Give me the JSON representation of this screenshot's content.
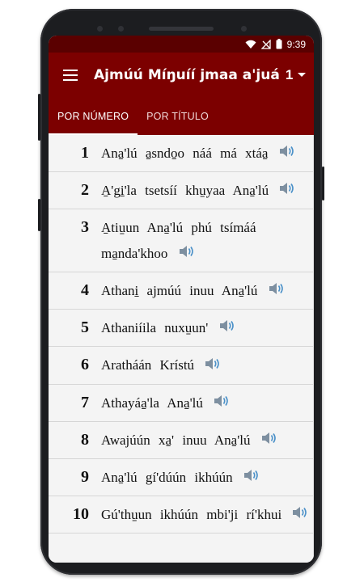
{
  "status": {
    "time": "9:39"
  },
  "appbar": {
    "title": "Ajmúú Míŋuíí jmaa a'juá",
    "book_number": "1"
  },
  "tabs": [
    {
      "label": "POR NÚMERO",
      "active": true
    },
    {
      "label": "POR TÍTULO",
      "active": false
    }
  ],
  "items": [
    {
      "number": "1",
      "title": "Ana̱'lú a̱sndo̱o náá má xtáa̱"
    },
    {
      "number": "2",
      "title": "A̱'gi̱'la tsetsíí khu̱yaa Ana̱'lú"
    },
    {
      "number": "3",
      "title": "A̱tiu̱un Ana̱'lú phú tsímáá ma̱nda'khoo"
    },
    {
      "number": "4",
      "title": "Athani̱ ajmúú inuu Ana̱'lú"
    },
    {
      "number": "5",
      "title": "Athaniíila nuxu̱un'"
    },
    {
      "number": "6",
      "title": "Aratháán Krístú"
    },
    {
      "number": "7",
      "title": "Athayáa̱'la Ana̱'lú"
    },
    {
      "number": "8",
      "title": "Awajúún xa̱' inuu Ana̱'lú"
    },
    {
      "number": "9",
      "title": "Ana̱'lú gí'dúún ikhúún"
    },
    {
      "number": "10",
      "title": "Gú'thu̱un ikhúún mbi'ji rí'khui"
    }
  ],
  "colors": {
    "primary": "#7c0000",
    "status": "#5a0000",
    "speaker": "#4a90c8"
  },
  "icons": {
    "row_action": "speaker-icon",
    "menu": "hamburger-icon"
  }
}
